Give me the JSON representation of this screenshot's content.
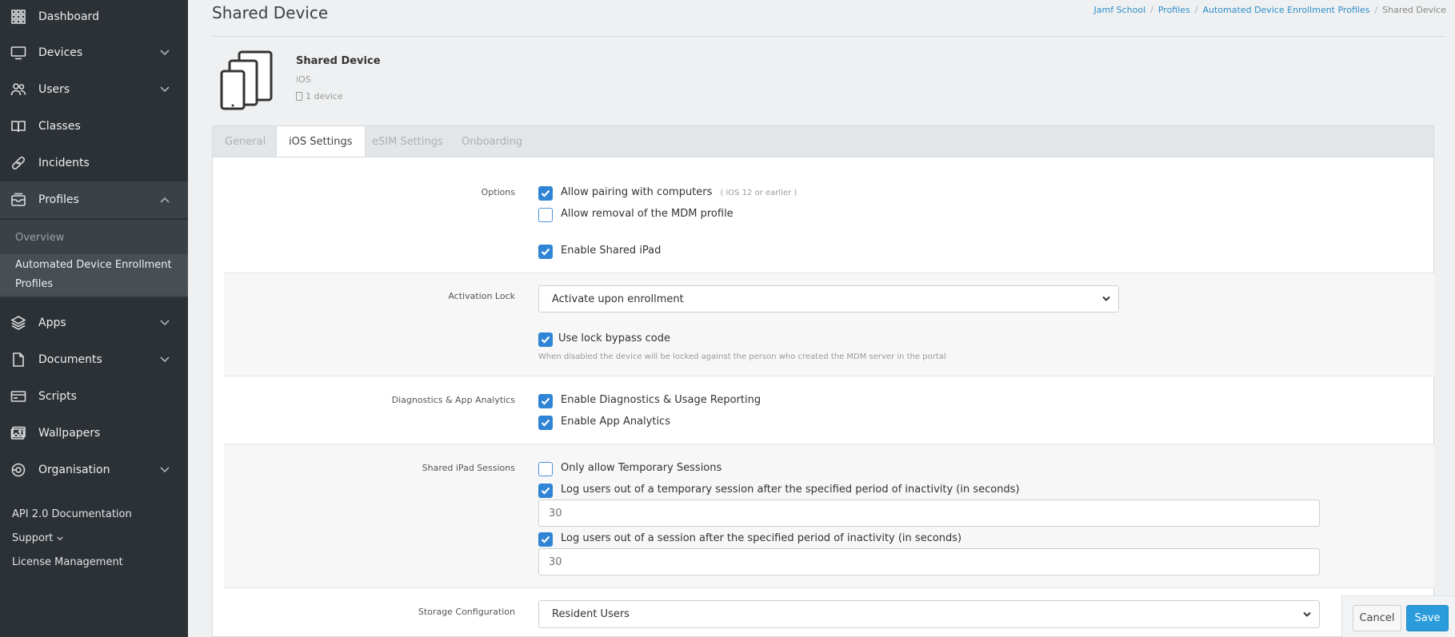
{
  "sidebar": {
    "items": [
      {
        "label": "Dashboard",
        "icon": "grid-icon"
      },
      {
        "label": "Devices",
        "icon": "monitor-icon"
      },
      {
        "label": "Users",
        "icon": "users-icon"
      },
      {
        "label": "Classes",
        "icon": "book-icon"
      },
      {
        "label": "Incidents",
        "icon": "bandage-icon"
      },
      {
        "label": "Profiles",
        "icon": "profiles-icon"
      },
      {
        "label": "Apps",
        "icon": "layers-icon"
      },
      {
        "label": "Documents",
        "icon": "document-icon"
      },
      {
        "label": "Scripts",
        "icon": "terminal-icon"
      },
      {
        "label": "Wallpapers",
        "icon": "image-icon"
      },
      {
        "label": "Organisation",
        "icon": "settings-icon"
      }
    ],
    "profiles_sub": {
      "overview": "Overview",
      "ade_line1": "Automated Device Enrollment",
      "ade_line2": "Profiles"
    },
    "footer": {
      "api_docs": "API 2.0 Documentation",
      "support": "Support",
      "license": "License Management"
    }
  },
  "header": {
    "title": "Shared Device",
    "breadcrumb": [
      "Jamf School",
      "Profiles",
      "Automated Device Enrollment Profiles",
      "Shared Device"
    ]
  },
  "profile": {
    "name": "Shared Device",
    "os": "iOS",
    "device_count": "1 device"
  },
  "tabs": [
    "General",
    "iOS Settings",
    "eSIM Settings",
    "Onboarding"
  ],
  "options": {
    "label": "Options",
    "allow_pairing": "Allow pairing with computers",
    "allow_pairing_hint": "( iOS 12 or earlier )",
    "allow_removal": "Allow removal of the MDM profile",
    "enable_shared_ipad": "Enable Shared iPad"
  },
  "activation_lock": {
    "label": "Activation Lock",
    "selected": "Activate upon enrollment",
    "bypass": "Use lock bypass code",
    "note": "When disabled the device will be locked against the person who created the MDM server in the portal"
  },
  "diagnostics": {
    "label": "Diagnostics & App Analytics",
    "usage": "Enable Diagnostics & Usage Reporting",
    "analytics": "Enable App Analytics"
  },
  "sessions": {
    "label": "Shared iPad Sessions",
    "temp_only": "Only allow Temporary Sessions",
    "temp_logout": "Log users out of a temporary session after the specified period of inactivity (in seconds)",
    "temp_value": "30",
    "logout": "Log users out of a session after the specified period of inactivity (in seconds)",
    "logout_value": "30"
  },
  "storage": {
    "label": "Storage Configuration",
    "selected": "Resident Users"
  },
  "actions": {
    "cancel": "Cancel",
    "save": "Save"
  },
  "colors": {
    "sidebar_bg": "#2c3135",
    "accent": "#2f84d6",
    "save_button": "#2a9cdb",
    "link": "#2d8ec9"
  }
}
